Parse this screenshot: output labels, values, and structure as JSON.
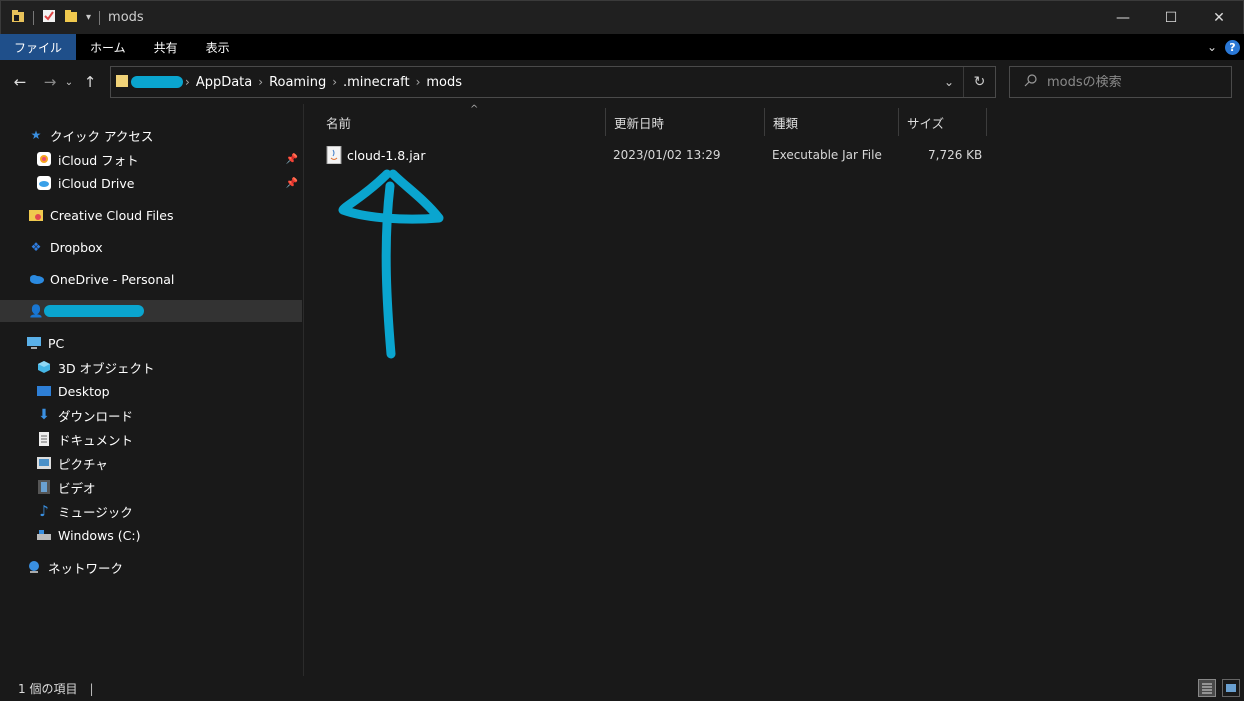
{
  "window": {
    "title": "mods",
    "minimize": "—",
    "maximize": "☐",
    "close": "✕"
  },
  "ribbon": {
    "tabs": [
      "ファイル",
      "ホーム",
      "共有",
      "表示"
    ],
    "help": "?"
  },
  "address": {
    "crumbs": [
      "AppData",
      "Roaming",
      ".minecraft",
      "mods"
    ],
    "separator": "›"
  },
  "search": {
    "placeholder": "modsの検索"
  },
  "sidebar": {
    "quick_access": "クイック アクセス",
    "icloud_photos": "iCloud フォト",
    "icloud_drive": "iCloud Drive",
    "creative_cloud": "Creative Cloud Files",
    "dropbox": "Dropbox",
    "onedrive": "OneDrive - Personal",
    "pc": "PC",
    "objects3d": "3D オブジェクト",
    "desktop": "Desktop",
    "downloads": "ダウンロード",
    "documents": "ドキュメント",
    "pictures": "ピクチャ",
    "videos": "ビデオ",
    "music": "ミュージック",
    "windows_c": "Windows (C:)",
    "network": "ネットワーク"
  },
  "columns": {
    "name": "名前",
    "modified": "更新日時",
    "type": "種類",
    "size": "サイズ"
  },
  "files": [
    {
      "name": "cloud-1.8.jar",
      "modified": "2023/01/02 13:29",
      "type": "Executable Jar File",
      "size": "7,726 KB"
    }
  ],
  "status": {
    "count": "1 個の項目"
  },
  "colors": {
    "accent": "#0aa5cf",
    "ribbon_active": "#1f4f8a",
    "background": "#191919"
  }
}
